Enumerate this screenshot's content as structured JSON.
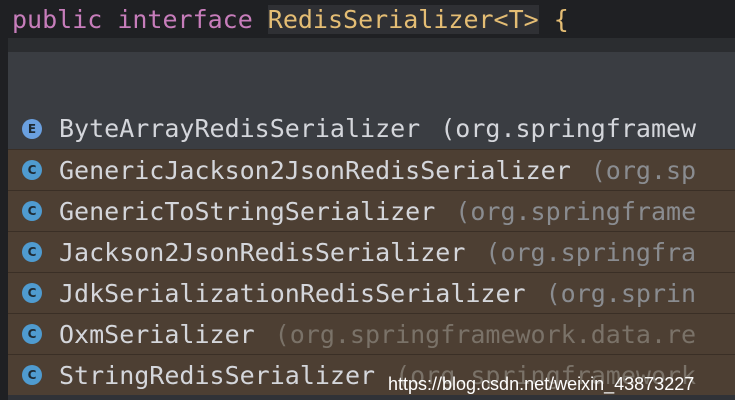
{
  "code": {
    "keyword1": "public",
    "keyword2": "interface",
    "type_name": "RedisSerializer<T>",
    "brace": "{"
  },
  "suggestions": [
    {
      "icon": "E",
      "name": "ByteArrayRedisSerializer",
      "package": "(org.springframew"
    },
    {
      "icon": "C",
      "name": "GenericJackson2JsonRedisSerializer",
      "package": "(org.sp"
    },
    {
      "icon": "C",
      "name": "GenericToStringSerializer",
      "package": "(org.springframe"
    },
    {
      "icon": "C",
      "name": "Jackson2JsonRedisSerializer",
      "package": "(org.springfra"
    },
    {
      "icon": "C",
      "name": "JdkSerializationRedisSerializer",
      "package": "(org.sprin"
    },
    {
      "icon": "C",
      "name": "OxmSerializer",
      "package": "(org.springframework.data.re"
    },
    {
      "icon": "C",
      "name": "StringRedisSerializer",
      "package": "(org.springframework"
    }
  ],
  "watermark": "https://blog.csdn.net/weixin_43873227",
  "colors": {
    "keyword": "#c77dbb",
    "type": "#e4bd74",
    "row_highlight": "#4d3f33",
    "class_icon": "#4f9bd0"
  }
}
